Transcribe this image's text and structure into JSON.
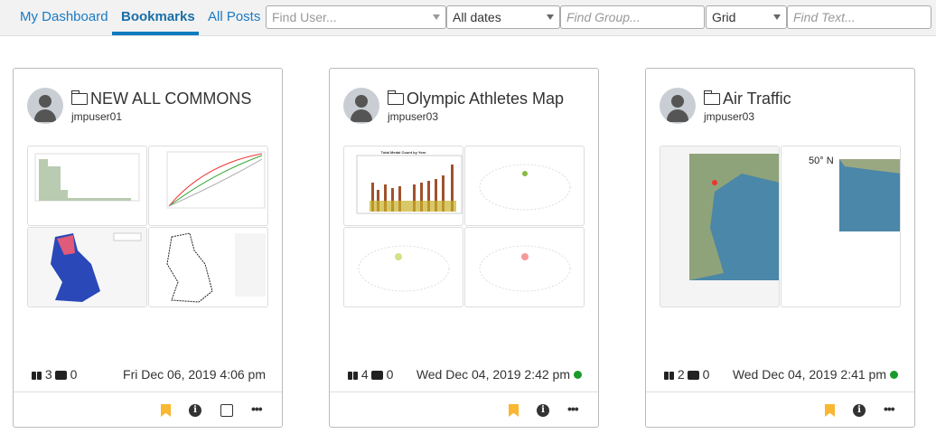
{
  "nav": {
    "tabs": [
      {
        "label": "My Dashboard"
      },
      {
        "label": "Bookmarks",
        "active": true
      },
      {
        "label": "All Posts"
      }
    ]
  },
  "filters": {
    "user_placeholder": "Find User...",
    "dates": "All dates",
    "group_placeholder": "Find Group...",
    "view": "Grid",
    "text_placeholder": "Find Text..."
  },
  "colors": {
    "accent": "#0f7bc0",
    "bookmark": "#f9b732",
    "online": "#1a9a2a"
  },
  "cards": [
    {
      "title": "NEW ALL COMMONS",
      "user": "jmpuser01",
      "views": "3",
      "comments": "0",
      "date": "Fri Dec 06, 2019 4:06 pm",
      "online": false,
      "editable": true
    },
    {
      "title": "Olympic Athletes Map",
      "user": "jmpuser03",
      "views": "4",
      "comments": "0",
      "date": "Wed Dec 04, 2019 2:42 pm",
      "online": true,
      "editable": false,
      "thumb_title": "Total Medal Count by Year"
    },
    {
      "title": "Air Traffic",
      "user": "jmpuser03",
      "views": "2",
      "comments": "0",
      "date": "Wed Dec 04, 2019 2:41 pm",
      "online": true,
      "editable": false,
      "map_label": "50° N"
    }
  ]
}
